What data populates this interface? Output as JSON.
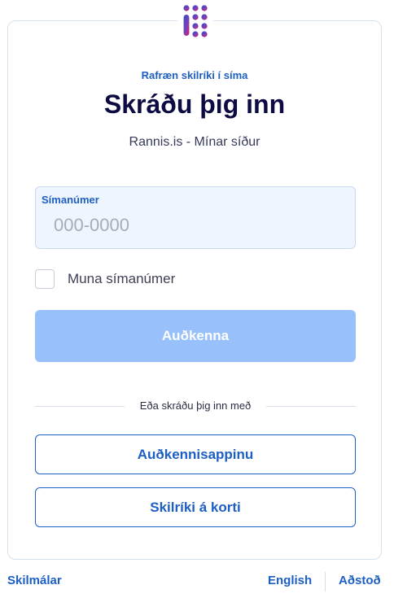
{
  "header": {
    "eyebrow": "Rafræn skilríki í síma",
    "title": "Skráðu þig inn",
    "subtitle": "Rannis.is - Mínar síður"
  },
  "phone_field": {
    "label": "Símanúmer",
    "placeholder": "000-0000",
    "value": ""
  },
  "remember": {
    "label": "Muna símanúmer",
    "checked": false
  },
  "submit_label": "Auðkenna",
  "divider_text": "Eða skráðu þig inn með",
  "alternatives": {
    "app_label": "Auðkennisappinu",
    "card_label": "Skilríki á korti"
  },
  "footer": {
    "terms": "Skilmálar",
    "language": "English",
    "help": "Aðstoð"
  },
  "colors": {
    "accent": "#1d5fc3",
    "disabled_button": "#98c0fb",
    "logo_gradient": [
      "#2b4fc9",
      "#7b3fb5",
      "#e0176d"
    ]
  },
  "icons": {
    "logo": "dot-grid-logo-icon"
  }
}
